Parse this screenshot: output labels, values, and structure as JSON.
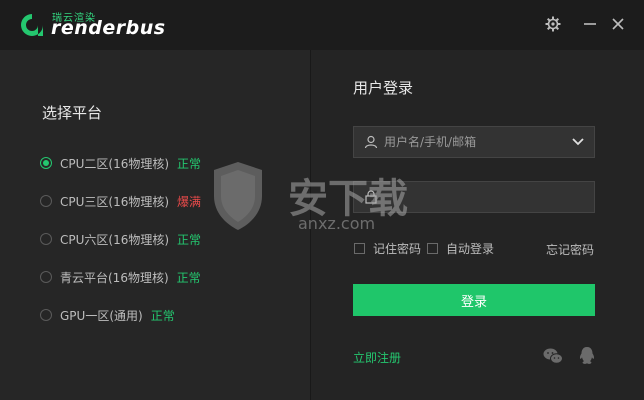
{
  "app": {
    "logo_small": "瑞云渲染",
    "logo_word": "renderbus",
    "accent": "#24c76f"
  },
  "titlebar": {
    "icons": [
      "gear-icon",
      "minimize-icon",
      "close-icon"
    ]
  },
  "platform": {
    "title": "选择平台",
    "items": [
      {
        "label": "CPU二区(16物理核)",
        "status": "正常",
        "status_color": "#24c76f",
        "selected": true
      },
      {
        "label": "CPU三区(16物理核)",
        "status": "爆满",
        "status_color": "#e84a4a",
        "selected": false
      },
      {
        "label": "CPU六区(16物理核)",
        "status": "正常",
        "status_color": "#24c76f",
        "selected": false
      },
      {
        "label": "青云平台(16物理核)",
        "status": "正常",
        "status_color": "#24c76f",
        "selected": false
      },
      {
        "label": "GPU一区(通用)",
        "status": "正常",
        "status_color": "#24c76f",
        "selected": false
      }
    ]
  },
  "login": {
    "title": "用户登录",
    "username_placeholder": "用户名/手机/邮箱",
    "username_value": "",
    "password_placeholder": "",
    "password_value": "",
    "remember_label": "记住密码",
    "auto_login_label": "自动登录",
    "forgot_label": "忘记密码",
    "button_label": "登录",
    "register_label": "立即注册",
    "social_icons": [
      "wechat-icon",
      "qq-icon"
    ]
  },
  "watermark": {
    "text": "安下载",
    "sub": "anxz.com"
  }
}
